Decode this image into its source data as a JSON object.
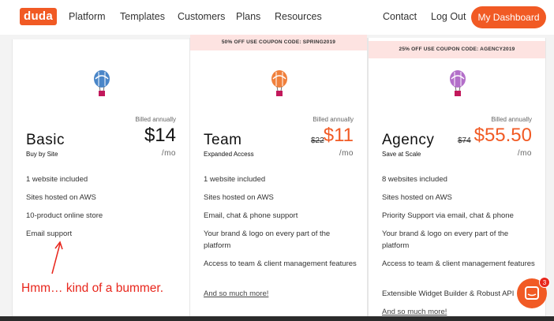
{
  "nav": {
    "logo": "duda",
    "links": [
      "Platform",
      "Templates",
      "Customers",
      "Plans",
      "Resources"
    ],
    "contact": "Contact",
    "logout": "Log Out",
    "dashboard": "My Dashboard",
    "accent": "#f15a24"
  },
  "plans": [
    {
      "name": "Basic",
      "subtitle": "Buy by Site",
      "billed": "Billed annually",
      "price": "$14",
      "per": "/mo",
      "balloon_color": "#4a86c8",
      "features": [
        "1 website included",
        "Sites hosted on AWS",
        "10-product online store",
        "Email support"
      ]
    },
    {
      "name": "Team",
      "subtitle": "Expanded Access",
      "coupon": "50% OFF USE COUPON CODE: SPRING2019",
      "billed": "Billed annually",
      "old_price": "$22",
      "price": "$11",
      "per": "/mo",
      "balloon_color": "#f0803c",
      "features": [
        "1 website included",
        "Sites hosted on AWS",
        "Email, chat & phone support",
        "Your brand & logo on every part of the platform",
        "Access to team & client management features"
      ],
      "more": "And so much more!"
    },
    {
      "name": "Agency",
      "subtitle": "Save at Scale",
      "coupon": "25% OFF USE COUPON CODE: AGENCY2019",
      "billed": "Billed annually",
      "old_price": "$74",
      "price": "$55.50",
      "per": "/mo",
      "balloon_color": "#b36fc9",
      "features": [
        "8 websites included",
        "Sites hosted on AWS",
        "Priority Support via email, chat & phone",
        "Your brand & logo on every part of the platform",
        "Access to team & client management features",
        "Extensible Widget Builder & Robust API"
      ],
      "more": "And so much more!"
    }
  ],
  "annotation": {
    "text": "Hmm… kind of a bummer.",
    "color": "#e8261c"
  },
  "chat": {
    "badge": "3"
  }
}
